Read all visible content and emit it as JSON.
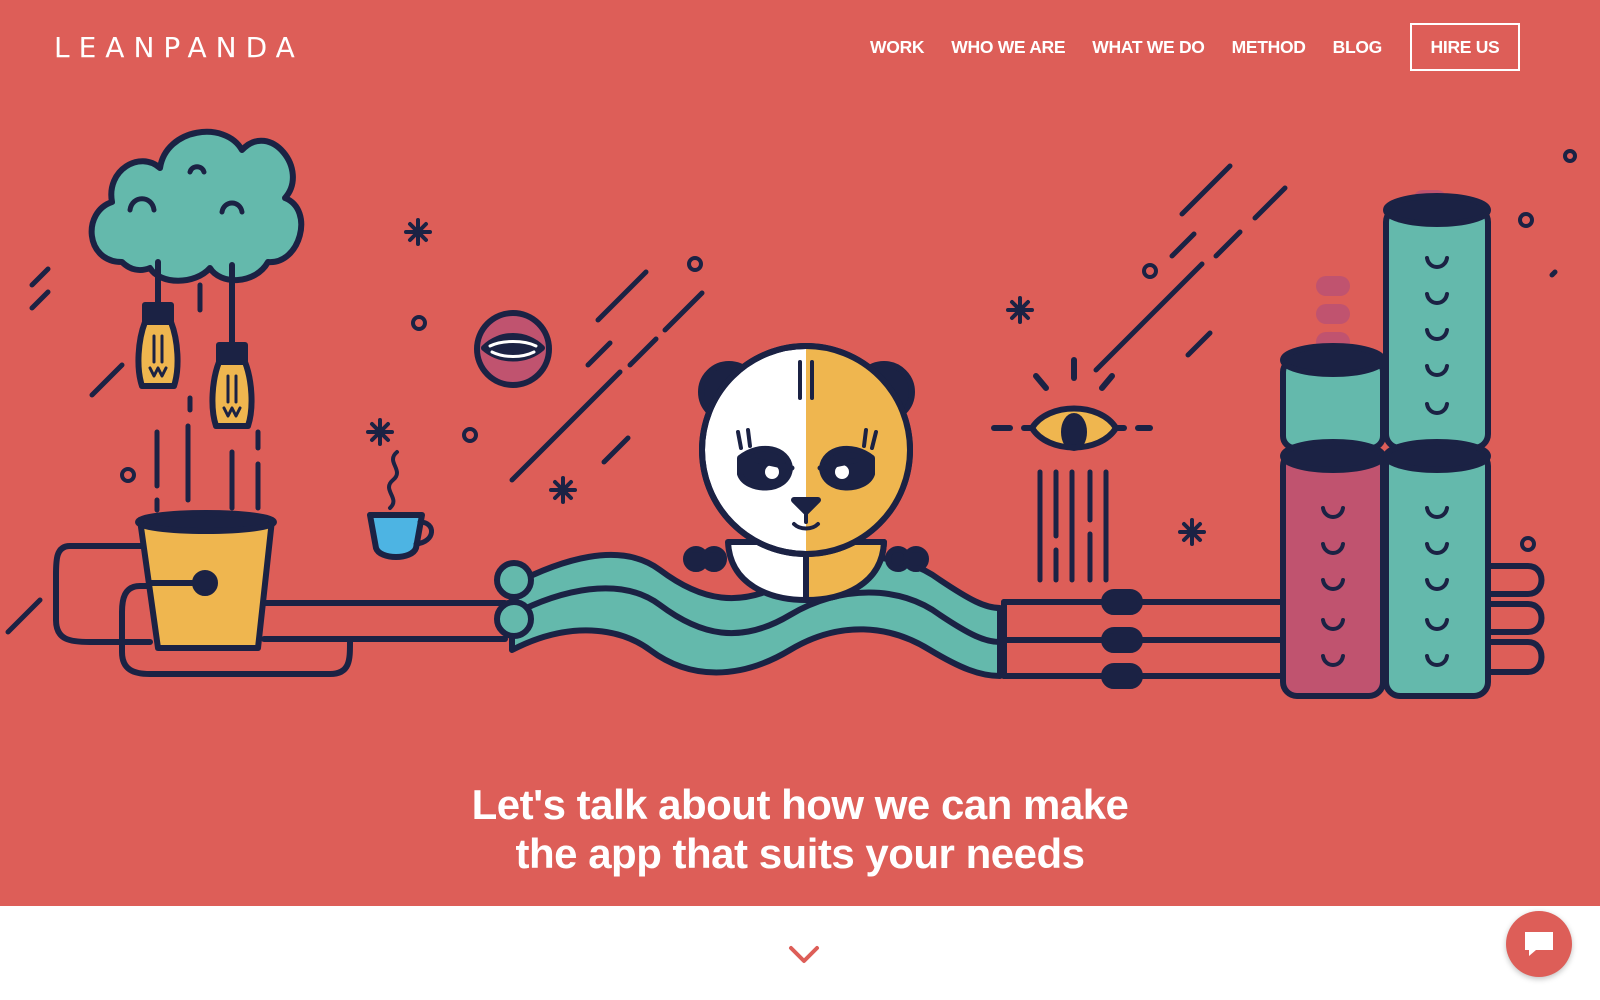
{
  "brand": {
    "logo_text": "LEANPANDA"
  },
  "nav": {
    "items": [
      {
        "label": "WORK"
      },
      {
        "label": "WHO WE ARE"
      },
      {
        "label": "WHAT WE DO"
      },
      {
        "label": "METHOD"
      },
      {
        "label": "BLOG"
      }
    ],
    "cta_label": "HIRE US"
  },
  "hero": {
    "headline_line1": "Let's talk about how we can make",
    "headline_line2": "the app that suits your needs"
  },
  "icons": {
    "scroll": "chevron-down-icon",
    "chat": "chat-bubble-icon"
  },
  "colors": {
    "hero_bg": "#dd5e58",
    "navy": "#1b2244",
    "teal": "#64b9ac",
    "yellow": "#efb64f",
    "magenta": "#c0536f",
    "cup_blue": "#4db4e3",
    "white": "#ffffff"
  }
}
